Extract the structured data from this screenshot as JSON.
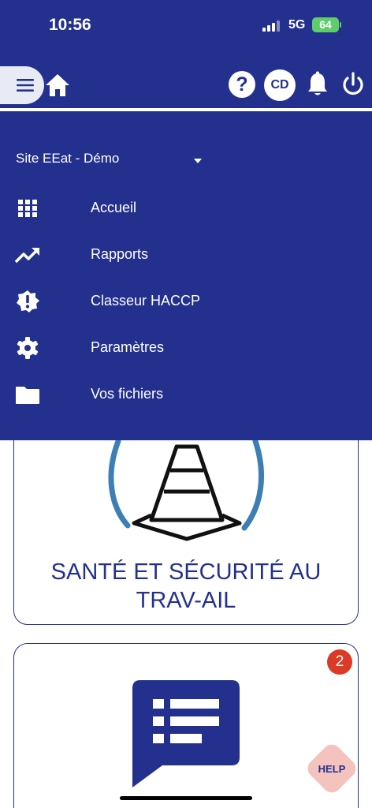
{
  "status_bar": {
    "time": "10:56",
    "network": "5G",
    "battery": "64"
  },
  "header": {
    "avatar_initials": "CD",
    "help_symbol": "?"
  },
  "drawer": {
    "site": "Site EEat - Démo",
    "items": [
      {
        "label": "Accueil",
        "icon": "grid-icon"
      },
      {
        "label": "Rapports",
        "icon": "trending-up-icon"
      },
      {
        "label": "Classeur HACCP",
        "icon": "alert-badge-icon"
      },
      {
        "label": "Paramètres",
        "icon": "gear-icon"
      },
      {
        "label": "Vos fichiers",
        "icon": "folder-icon"
      }
    ]
  },
  "cards": [
    {
      "title": "SANTÉ ET SÉCURITÉ AU TRAV-AIL",
      "icon": "traffic-cone-icon"
    },
    {
      "icon": "list-chat-icon",
      "badge": "2"
    }
  ],
  "help_fab": {
    "label": "HELP"
  },
  "colors": {
    "brand": "#23308e",
    "badge": "#db3a27",
    "help": "#f3b9b3"
  }
}
